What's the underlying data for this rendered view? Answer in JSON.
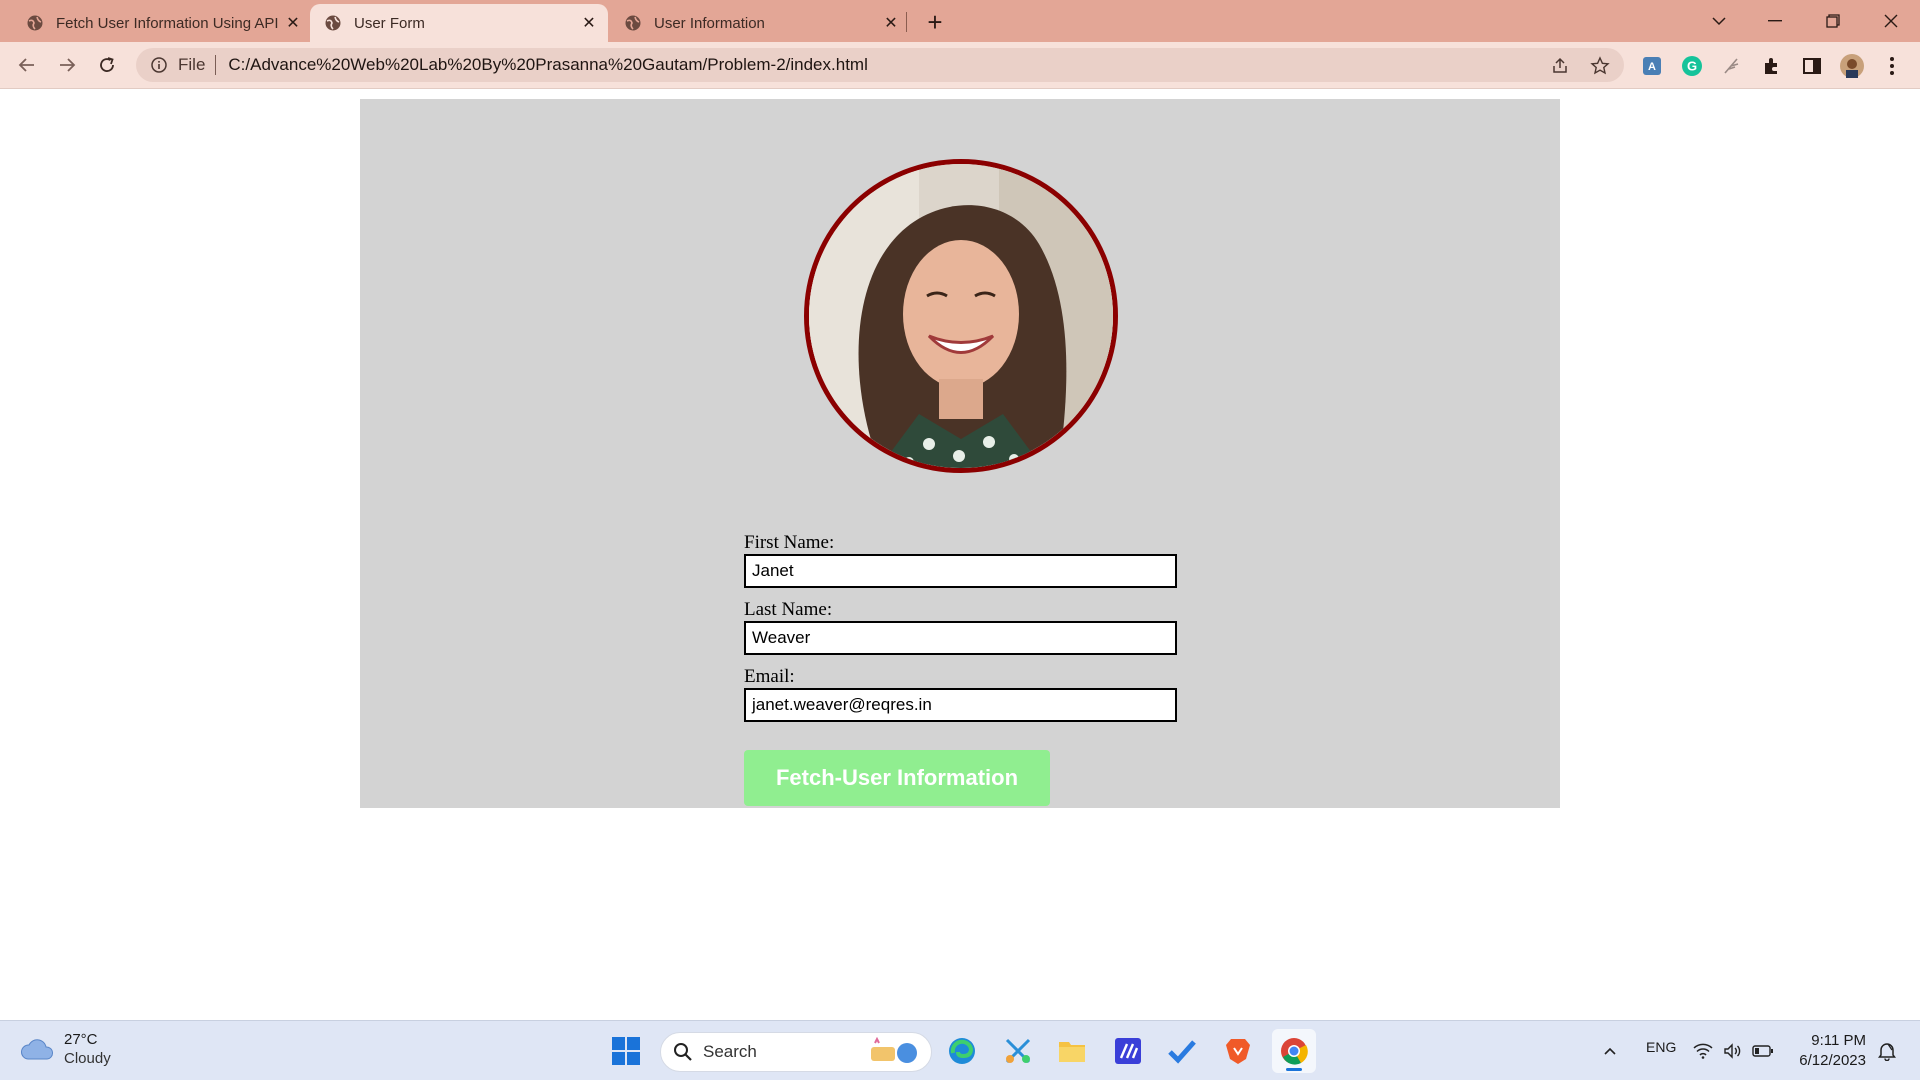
{
  "browser": {
    "tabs": [
      {
        "title": "Fetch User Information Using API",
        "active": false
      },
      {
        "title": "User Form",
        "active": true
      },
      {
        "title": "User Information",
        "active": false
      }
    ],
    "address": {
      "scheme_label": "File",
      "url": "C:/Advance%20Web%20Lab%20By%20Prasanna%20Gautam/Problem-2/index.html"
    }
  },
  "page": {
    "avatar_alt": "User avatar photo",
    "fields": {
      "first_name": {
        "label": "First Name:",
        "value": "Janet"
      },
      "last_name": {
        "label": "Last Name:",
        "value": "Weaver"
      },
      "email": {
        "label": "Email:",
        "value": "janet.weaver@reqres.in"
      }
    },
    "button_label": "Fetch-User Information",
    "colors": {
      "card_bg": "#d3d3d3",
      "avatar_border": "#8b0000",
      "button_bg": "#90ee90"
    }
  },
  "taskbar": {
    "weather": {
      "temp": "27°C",
      "condition": "Cloudy"
    },
    "search_label": "Search",
    "language": "ENG",
    "time": "9:11 PM",
    "date": "6/12/2023"
  }
}
